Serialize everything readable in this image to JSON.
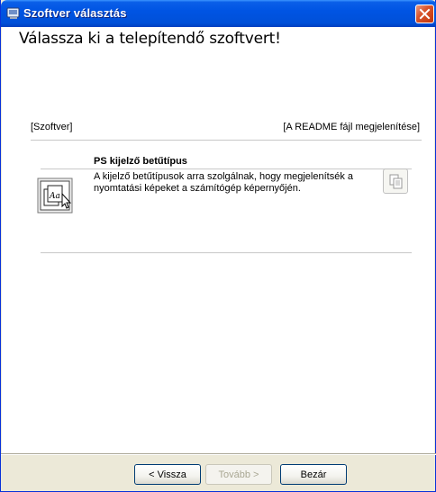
{
  "window": {
    "title": "Szoftver választás",
    "heading": "Válassza ki a telepítendő szoftvert!"
  },
  "list": {
    "col_software": "[Szoftver]",
    "col_readme": "[A README fájl megjelenítése]",
    "items": [
      {
        "title": "PS kijelző betűtípus",
        "description": "A kijelző betűtípusok arra szolgálnak, hogy megjelenítsék a nyomtatási képeket a számítógép képernyőjén.",
        "icon_text": "Aa"
      }
    ]
  },
  "buttons": {
    "back": "< Vissza",
    "next": "Tovább >",
    "close": "Bezár"
  },
  "colors": {
    "titlebar": "#0054e3",
    "window_bg": "#ece9d8",
    "content_bg": "#ffffff"
  }
}
